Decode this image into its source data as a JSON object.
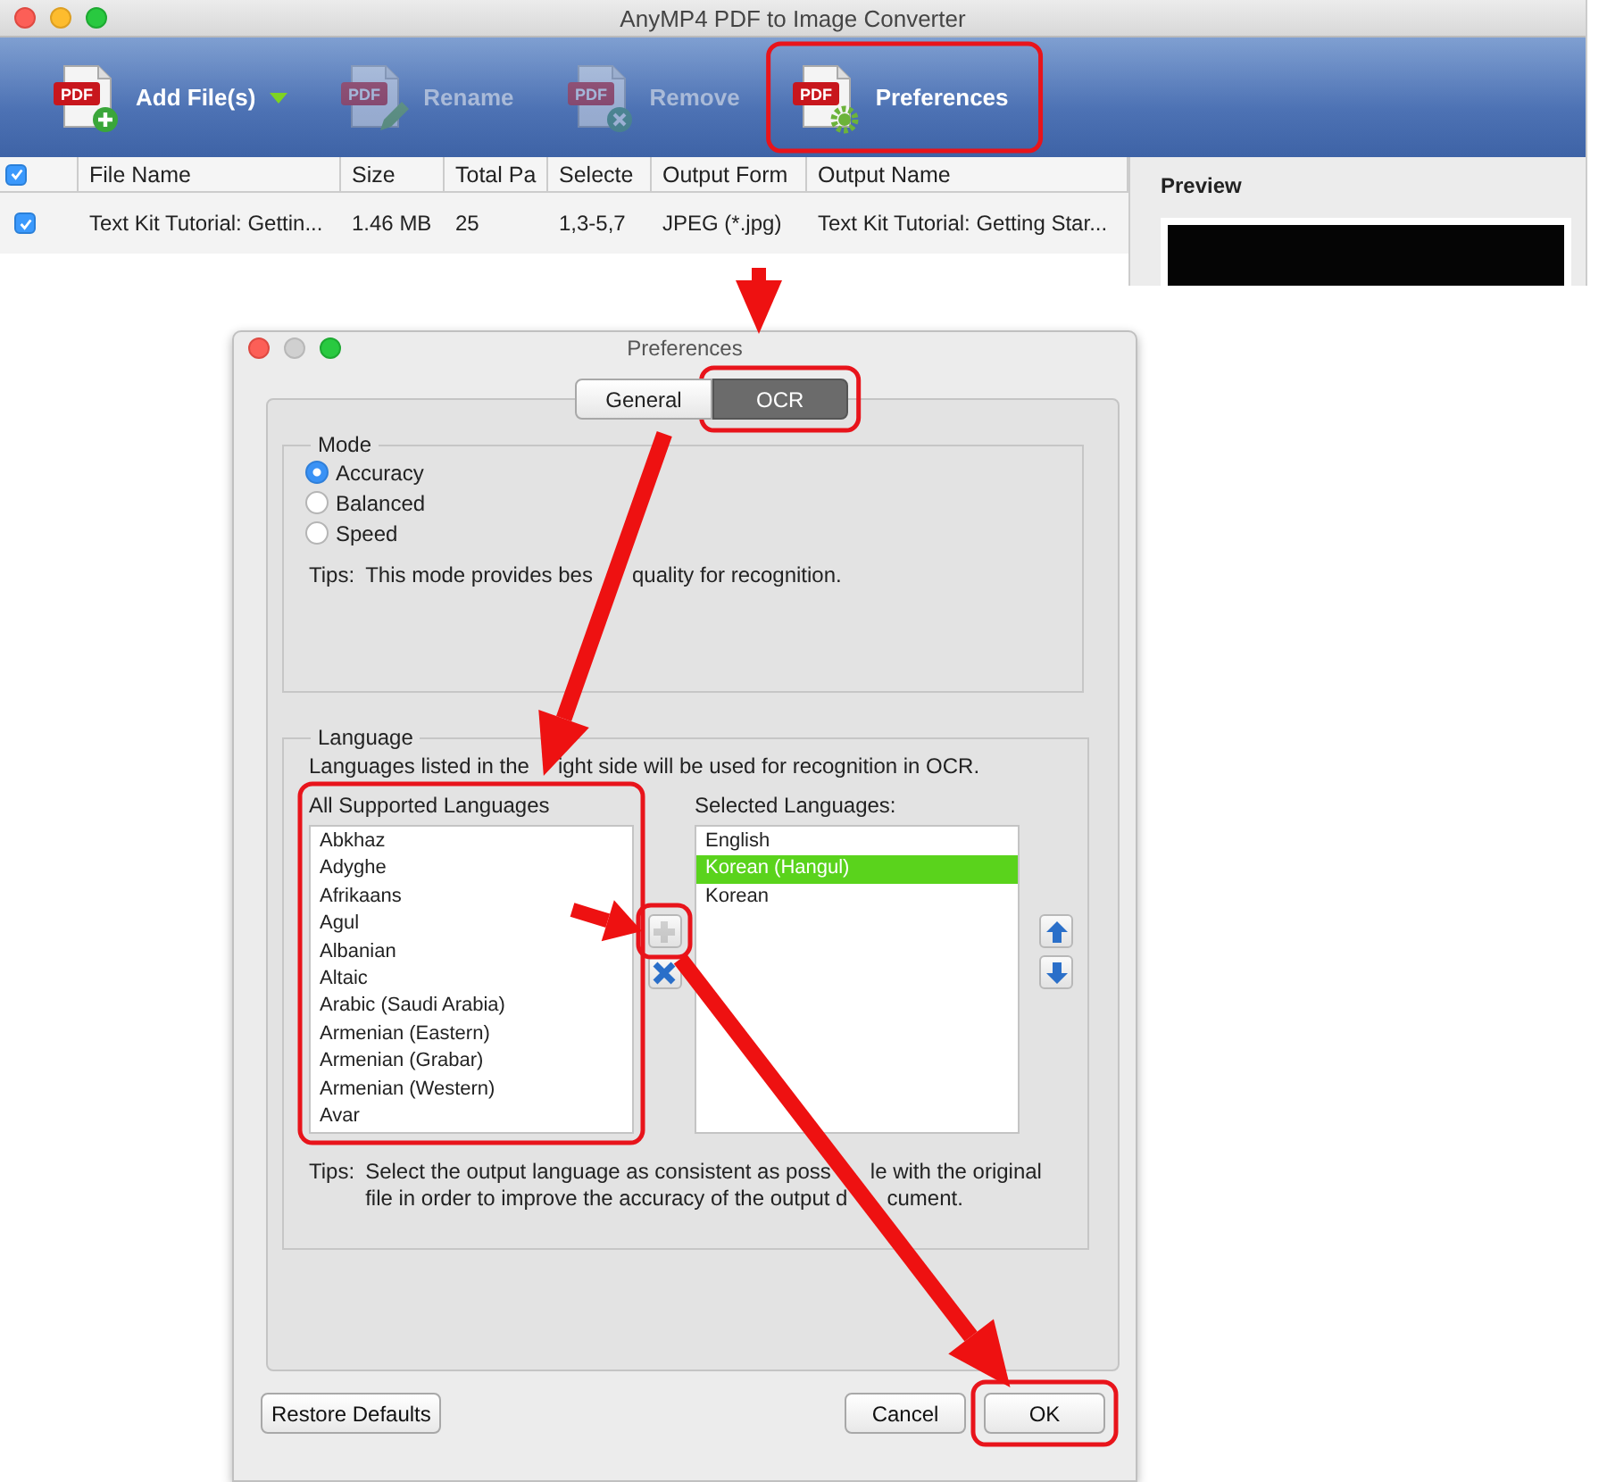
{
  "main_window": {
    "title": "AnyMP4 PDF to Image Converter",
    "toolbar": [
      {
        "label": "Add File(s)",
        "kind": "add",
        "icon_text": "PDF",
        "disabled": false,
        "dropdown": true
      },
      {
        "label": "Rename",
        "kind": "rename",
        "icon_text": "PDF",
        "disabled": true,
        "dropdown": false
      },
      {
        "label": "Remove",
        "kind": "remove",
        "icon_text": "PDF",
        "disabled": true,
        "dropdown": false
      },
      {
        "label": "Preferences",
        "kind": "preferences",
        "icon_text": "PDF",
        "disabled": false,
        "dropdown": false
      }
    ],
    "table": {
      "header_checked": true,
      "columns": [
        "File Name",
        "Size",
        "Total Pa",
        "Selecte",
        "Output Form",
        "Output Name"
      ],
      "rows": [
        {
          "checked": true,
          "cells": [
            "Text Kit Tutorial: Gettin...",
            "1.46 MB",
            "25",
            "1,3-5,7",
            "JPEG (*.jpg)",
            "Text Kit Tutorial: Getting Star..."
          ]
        }
      ]
    },
    "preview": {
      "title": "Preview"
    }
  },
  "dialog": {
    "title": "Preferences",
    "tabs": [
      {
        "label": "General",
        "selected": false
      },
      {
        "label": "OCR",
        "selected": true
      }
    ],
    "mode": {
      "title": "Mode",
      "options": [
        {
          "label": "Accuracy",
          "selected": true
        },
        {
          "label": "Balanced",
          "selected": false
        },
        {
          "label": "Speed",
          "selected": false
        }
      ],
      "tips_label": "Tips:",
      "tips": [
        "This mode provides bes",
        "quality for recognition."
      ]
    },
    "language": {
      "title": "Language",
      "description": [
        "Languages listed in the",
        "ight side will be used for recognition in OCR."
      ],
      "all_title": "All Supported Languages",
      "all": [
        {
          "label": "Abkhaz",
          "selected": false
        },
        {
          "label": "Adyghe",
          "selected": false
        },
        {
          "label": "Afrikaans",
          "selected": false
        },
        {
          "label": "Agul",
          "selected": false
        },
        {
          "label": "Albanian",
          "selected": false
        },
        {
          "label": "Altaic",
          "selected": false
        },
        {
          "label": "Arabic (Saudi Arabia)",
          "selected": false
        },
        {
          "label": "Armenian (Eastern)",
          "selected": false
        },
        {
          "label": "Armenian (Grabar)",
          "selected": false
        },
        {
          "label": "Armenian (Western)",
          "selected": false
        },
        {
          "label": "Avar",
          "selected": false
        }
      ],
      "selected_title": "Selected Languages:",
      "chosen": [
        {
          "label": "English",
          "selected": false
        },
        {
          "label": "Korean (Hangul)",
          "selected": true
        },
        {
          "label": "Korean",
          "selected": false
        }
      ],
      "add_disabled": true,
      "remove_disabled": false,
      "tips_label": "Tips:",
      "tips_lines": [
        [
          "Select the output language as consistent as poss",
          "le with the original"
        ],
        [
          "file in order to improve the accuracy of the output d",
          "cument."
        ]
      ]
    },
    "buttons": {
      "restore": "Restore Defaults",
      "cancel": "Cancel",
      "ok": "OK"
    }
  }
}
